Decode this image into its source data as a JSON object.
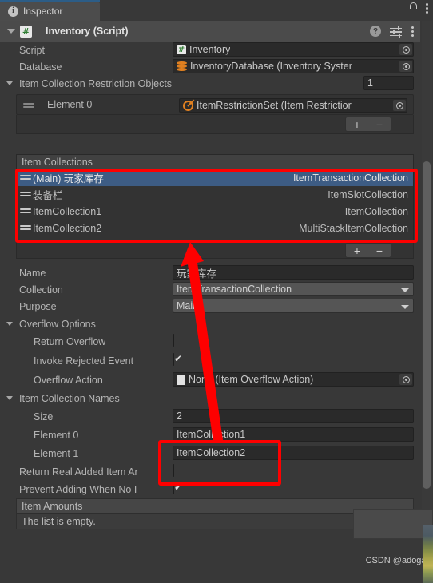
{
  "window": {
    "tab_label": "Inspector",
    "tab_icon": "info-icon",
    "lock_icon": "lock-icon",
    "menu_icon": "kebab-menu-icon",
    "accent_color": "#2c5d87"
  },
  "component": {
    "title": "Inventory (Script)",
    "script_icon": "csharp-script-icon",
    "script_icon_glyph": "#",
    "help_icon": "help-icon",
    "help_glyph": "?",
    "preset_icon": "preset-icon",
    "menu_icon": "kebab-menu-icon"
  },
  "fields": {
    "script": {
      "label": "Script",
      "value": "Inventory",
      "icon": "csharp-script-icon",
      "icon_glyph": "#"
    },
    "database": {
      "label": "Database",
      "value": "InventoryDatabase (Inventory Syster",
      "icon": "database-icon"
    },
    "restriction_objects": {
      "label": "Item Collection Restriction Objects",
      "size": "1",
      "element_label": "Element 0",
      "element_value": "ItemRestrictionSet (Item Restrictior",
      "element_icon": "no-entry-icon"
    },
    "name": {
      "label": "Name",
      "value": "玩家库存"
    },
    "collection": {
      "label": "Collection",
      "value": "ItemTransactionCollection"
    },
    "purpose": {
      "label": "Purpose",
      "value": "Main"
    },
    "overflow_options": {
      "label": "Overflow Options"
    },
    "return_overflow": {
      "label": "Return Overflow",
      "checked": false
    },
    "invoke_rejected_event": {
      "label": "Invoke Rejected Event",
      "checked": true
    },
    "overflow_action": {
      "label": "Overflow Action",
      "value": "None (Item Overflow Action)",
      "icon": "document-icon"
    },
    "item_collection_names": {
      "label": "Item Collection Names"
    },
    "size": {
      "label": "Size",
      "value": "2"
    },
    "element0": {
      "label": "Element 0",
      "value": "ItemCollection1"
    },
    "element1": {
      "label": "Element 1",
      "value": "ItemCollection2"
    },
    "return_real_added": {
      "label": "Return Real Added Item Ar",
      "checked": false
    },
    "prevent_adding": {
      "label": "Prevent Adding When No I",
      "checked": true
    },
    "item_amounts": {
      "label": "Item Amounts",
      "empty_text": "The list is empty."
    }
  },
  "item_collections": {
    "header": "Item Collections",
    "rows": [
      {
        "name": "(Main) 玩家库存",
        "type": "ItemTransactionCollection",
        "selected": true
      },
      {
        "name": "装备栏",
        "type": "ItemSlotCollection",
        "selected": false
      },
      {
        "name": "ItemCollection1",
        "type": "ItemCollection",
        "selected": false
      },
      {
        "name": "ItemCollection2",
        "type": "MultiStackItemCollection",
        "selected": false
      }
    ]
  },
  "buttons": {
    "add": "+",
    "remove": "−"
  },
  "annotations": {
    "highlight_color": "#fe0000",
    "box1_name": "item-collections-highlight",
    "box2_name": "element-values-highlight",
    "arrow_name": "annotation-arrow"
  },
  "watermark": {
    "text": "CSDN @adogai"
  }
}
